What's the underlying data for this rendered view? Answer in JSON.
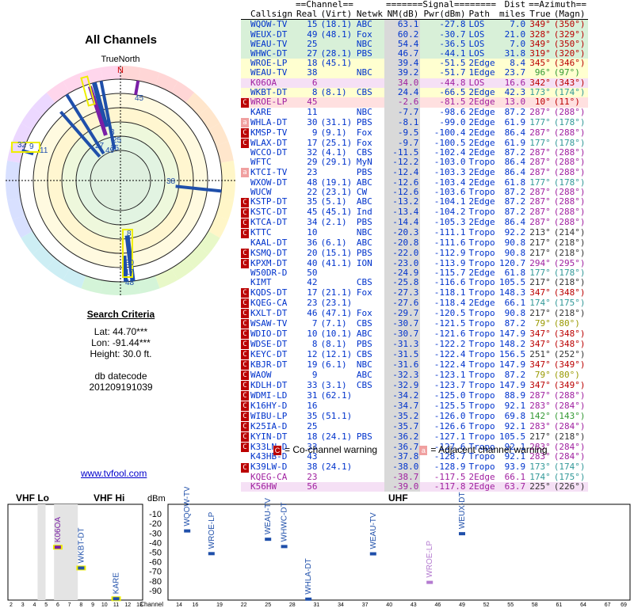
{
  "polar": {
    "title": "All Channels",
    "north_label": "TrueNorth",
    "n_label": "N",
    "ring_labels": [
      "45",
      "25",
      "15",
      "8",
      "5",
      "27",
      "49",
      "11",
      "32",
      "9",
      "38",
      "8",
      "30",
      "17",
      "48"
    ]
  },
  "criteria": {
    "header": "Search Criteria",
    "lat": "Lat: 44.70***",
    "lon": "Lon: -91.44***",
    "height": "Height: 30.0 ft.",
    "db_label": "db datecode",
    "db_value": "201209191039"
  },
  "table": {
    "group_headers": {
      "channel": "==Channel==",
      "signal": "=======Signal========",
      "dist": "Dist",
      "azimuth": "==Azimuth=="
    },
    "columns": [
      "Callsign",
      "Real",
      "(Virt)",
      "Netwk",
      "NM(dB)",
      "Pwr(dBm)",
      "Path",
      "miles",
      "True",
      "(Magn)"
    ],
    "rows": [
      {
        "flag": "",
        "call": "WQOW-TV",
        "real": "15",
        "virt": "(18.1)",
        "net": "ABC",
        "nm": "63.1",
        "pwr": "-27.8",
        "path": "LOS",
        "miles": "7.0",
        "tru": "349°",
        "mag": "(350°)",
        "bg": "#d8f0d8",
        "fg": "#0033cc",
        "az": "#b00"
      },
      {
        "flag": "",
        "call": "WEUX-DT",
        "real": "49",
        "virt": "(48.1)",
        "net": "Fox",
        "nm": "60.2",
        "pwr": "-30.7",
        "path": "LOS",
        "miles": "21.0",
        "tru": "328°",
        "mag": "(329°)",
        "bg": "#d8f0d8",
        "fg": "#0033cc",
        "az": "#b00"
      },
      {
        "flag": "",
        "call": "WEAU-TV",
        "real": "25",
        "virt": "",
        "net": "NBC",
        "nm": "54.4",
        "pwr": "-36.5",
        "path": "LOS",
        "miles": "7.0",
        "tru": "349°",
        "mag": "(350°)",
        "bg": "#d8f0d8",
        "fg": "#0033cc",
        "az": "#b00"
      },
      {
        "flag": "",
        "call": "WHWC-DT",
        "real": "27",
        "virt": "(28.1)",
        "net": "PBS",
        "nm": "46.7",
        "pwr": "-44.1",
        "path": "LOS",
        "miles": "31.8",
        "tru": "319°",
        "mag": "(320°)",
        "bg": "#d8f0d8",
        "fg": "#0033cc",
        "az": "#b00"
      },
      {
        "flag": "",
        "call": "WROE-LP",
        "real": "18",
        "virt": "(45.1)",
        "net": "",
        "nm": "39.4",
        "pwr": "-51.5",
        "path": "2Edge",
        "miles": "8.4",
        "tru": "345°",
        "mag": "(346°)",
        "bg": "#ffffd0",
        "fg": "#0033cc",
        "az": "#b00"
      },
      {
        "flag": "",
        "call": "WEAU-TV",
        "real": "38",
        "virt": "",
        "net": "NBC",
        "nm": "39.2",
        "pwr": "-51.7",
        "path": "1Edge",
        "miles": "23.7",
        "tru": "96°",
        "mag": "(97°)",
        "bg": "#ffffd0",
        "fg": "#0033cc",
        "az": "#393"
      },
      {
        "flag": "",
        "call": "K06OA",
        "real": "6",
        "virt": "",
        "net": "",
        "nm": "34.0",
        "pwr": "-44.8",
        "path": "LOS",
        "miles": "16.6",
        "tru": "342°",
        "mag": "(343°)",
        "bg": "#f5e0f5",
        "fg": "#a020a0",
        "az": "#b00"
      },
      {
        "flag": "",
        "call": "WKBT-DT",
        "real": "8",
        "virt": "(8.1)",
        "net": "CBS",
        "nm": "24.4",
        "pwr": "-66.5",
        "path": "2Edge",
        "miles": "42.3",
        "tru": "173°",
        "mag": "(174°)",
        "bg": "#ffffd0",
        "fg": "#0033cc",
        "az": "#399"
      },
      {
        "flag": "C",
        "call": "WROE-LP",
        "real": "45",
        "virt": "",
        "net": "",
        "nm": "-2.6",
        "pwr": "-81.5",
        "path": "2Edge",
        "miles": "13.0",
        "tru": "10°",
        "mag": "(11°)",
        "bg": "#ffe0e0",
        "fg": "#a020a0",
        "az": "#b00"
      },
      {
        "flag": "",
        "call": "KARE",
        "real": "11",
        "virt": "",
        "net": "NBC",
        "nm": "-7.7",
        "pwr": "-98.6",
        "path": "2Edge",
        "miles": "87.2",
        "tru": "287°",
        "mag": "(288°)",
        "bg": "#fff",
        "fg": "#0033cc",
        "az": "#a020a0"
      },
      {
        "flag": "a",
        "call": "WHLA-DT",
        "real": "30",
        "virt": "(31.1)",
        "net": "PBS",
        "nm": "-8.1",
        "pwr": "-99.0",
        "path": "2Edge",
        "miles": "61.9",
        "tru": "177°",
        "mag": "(178°)",
        "bg": "#fff",
        "fg": "#0033cc",
        "az": "#399"
      },
      {
        "flag": "C",
        "call": "KMSP-TV",
        "real": "9",
        "virt": "(9.1)",
        "net": "Fox",
        "nm": "-9.5",
        "pwr": "-100.4",
        "path": "2Edge",
        "miles": "86.4",
        "tru": "287°",
        "mag": "(288°)",
        "bg": "#fff",
        "fg": "#0033cc",
        "az": "#a020a0"
      },
      {
        "flag": "C",
        "call": "WLAX-DT",
        "real": "17",
        "virt": "(25.1)",
        "net": "Fox",
        "nm": "-9.7",
        "pwr": "-100.5",
        "path": "2Edge",
        "miles": "61.9",
        "tru": "177°",
        "mag": "(178°)",
        "bg": "#fff",
        "fg": "#0033cc",
        "az": "#399"
      },
      {
        "flag": "",
        "call": "WCCO-DT",
        "real": "32",
        "virt": "(4.1)",
        "net": "CBS",
        "nm": "-11.5",
        "pwr": "-102.4",
        "path": "2Edge",
        "miles": "87.2",
        "tru": "287°",
        "mag": "(288°)",
        "bg": "#fff",
        "fg": "#0033cc",
        "az": "#a020a0"
      },
      {
        "flag": "",
        "call": "WFTC",
        "real": "29",
        "virt": "(29.1)",
        "net": "MyN",
        "nm": "-12.2",
        "pwr": "-103.0",
        "path": "Tropo",
        "miles": "86.4",
        "tru": "287°",
        "mag": "(288°)",
        "bg": "#fff",
        "fg": "#0033cc",
        "az": "#a020a0"
      },
      {
        "flag": "a",
        "call": "KTCI-TV",
        "real": "23",
        "virt": "",
        "net": "PBS",
        "nm": "-12.4",
        "pwr": "-103.3",
        "path": "2Edge",
        "miles": "86.4",
        "tru": "287°",
        "mag": "(288°)",
        "bg": "#fff",
        "fg": "#0033cc",
        "az": "#a020a0"
      },
      {
        "flag": "",
        "call": "WXOW-DT",
        "real": "48",
        "virt": "(19.1)",
        "net": "ABC",
        "nm": "-12.6",
        "pwr": "-103.4",
        "path": "2Edge",
        "miles": "61.8",
        "tru": "177°",
        "mag": "(178°)",
        "bg": "#fff",
        "fg": "#0033cc",
        "az": "#399"
      },
      {
        "flag": "",
        "call": "WUCW",
        "real": "22",
        "virt": "(23.1)",
        "net": "CW",
        "nm": "-12.6",
        "pwr": "-103.6",
        "path": "Tropo",
        "miles": "87.2",
        "tru": "287°",
        "mag": "(288°)",
        "bg": "#fff",
        "fg": "#0033cc",
        "az": "#a020a0"
      },
      {
        "flag": "C",
        "call": "KSTP-DT",
        "real": "35",
        "virt": "(5.1)",
        "net": "ABC",
        "nm": "-13.2",
        "pwr": "-104.1",
        "path": "2Edge",
        "miles": "87.2",
        "tru": "287°",
        "mag": "(288°)",
        "bg": "#fff",
        "fg": "#0033cc",
        "az": "#a020a0"
      },
      {
        "flag": "C",
        "call": "KSTC-DT",
        "real": "45",
        "virt": "(45.1)",
        "net": "Ind",
        "nm": "-13.4",
        "pwr": "-104.2",
        "path": "Tropo",
        "miles": "87.2",
        "tru": "287°",
        "mag": "(288°)",
        "bg": "#fff",
        "fg": "#0033cc",
        "az": "#a020a0"
      },
      {
        "flag": "C",
        "call": "KTCA-DT",
        "real": "34",
        "virt": "(2.1)",
        "net": "PBS",
        "nm": "-14.4",
        "pwr": "-105.3",
        "path": "2Edge",
        "miles": "86.4",
        "tru": "287°",
        "mag": "(288°)",
        "bg": "#fff",
        "fg": "#0033cc",
        "az": "#a020a0"
      },
      {
        "flag": "C",
        "call": "KTTC",
        "real": "10",
        "virt": "",
        "net": "NBC",
        "nm": "-20.3",
        "pwr": "-111.1",
        "path": "Tropo",
        "miles": "92.2",
        "tru": "213°",
        "mag": "(214°)",
        "bg": "#fff",
        "fg": "#0033cc",
        "az": "#333"
      },
      {
        "flag": "",
        "call": "KAAL-DT",
        "real": "36",
        "virt": "(6.1)",
        "net": "ABC",
        "nm": "-20.8",
        "pwr": "-111.6",
        "path": "Tropo",
        "miles": "90.8",
        "tru": "217°",
        "mag": "(218°)",
        "bg": "#fff",
        "fg": "#0033cc",
        "az": "#333"
      },
      {
        "flag": "C",
        "call": "KSMQ-DT",
        "real": "20",
        "virt": "(15.1)",
        "net": "PBS",
        "nm": "-22.0",
        "pwr": "-112.9",
        "path": "Tropo",
        "miles": "90.8",
        "tru": "217°",
        "mag": "(218°)",
        "bg": "#fff",
        "fg": "#0033cc",
        "az": "#333"
      },
      {
        "flag": "C",
        "call": "KPXM-DT",
        "real": "40",
        "virt": "(41.1)",
        "net": "ION",
        "nm": "-23.0",
        "pwr": "-113.9",
        "path": "Tropo",
        "miles": "120.7",
        "tru": "294°",
        "mag": "(295°)",
        "bg": "#fff",
        "fg": "#0033cc",
        "az": "#a020a0"
      },
      {
        "flag": "",
        "call": "W50DR-D",
        "real": "50",
        "virt": "",
        "net": "",
        "nm": "-24.9",
        "pwr": "-115.7",
        "path": "2Edge",
        "miles": "61.8",
        "tru": "177°",
        "mag": "(178°)",
        "bg": "#fff",
        "fg": "#0033cc",
        "az": "#399"
      },
      {
        "flag": "",
        "call": "KIMT",
        "real": "42",
        "virt": "",
        "net": "CBS",
        "nm": "-25.8",
        "pwr": "-116.6",
        "path": "Tropo",
        "miles": "105.5",
        "tru": "217°",
        "mag": "(218°)",
        "bg": "#fff",
        "fg": "#0033cc",
        "az": "#333"
      },
      {
        "flag": "C",
        "call": "KQDS-DT",
        "real": "17",
        "virt": "(21.1)",
        "net": "Fox",
        "nm": "-27.3",
        "pwr": "-118.1",
        "path": "Tropo",
        "miles": "148.3",
        "tru": "347°",
        "mag": "(348°)",
        "bg": "#fff",
        "fg": "#0033cc",
        "az": "#b00"
      },
      {
        "flag": "C",
        "call": "KQEG-CA",
        "real": "23",
        "virt": "(23.1)",
        "net": "",
        "nm": "-27.6",
        "pwr": "-118.4",
        "path": "2Edge",
        "miles": "66.1",
        "tru": "174°",
        "mag": "(175°)",
        "bg": "#fff",
        "fg": "#0033cc",
        "az": "#399"
      },
      {
        "flag": "C",
        "call": "KXLT-DT",
        "real": "46",
        "virt": "(47.1)",
        "net": "Fox",
        "nm": "-29.7",
        "pwr": "-120.5",
        "path": "Tropo",
        "miles": "90.8",
        "tru": "217°",
        "mag": "(218°)",
        "bg": "#fff",
        "fg": "#0033cc",
        "az": "#333"
      },
      {
        "flag": "C",
        "call": "WSAW-TV",
        "real": "7",
        "virt": "(7.1)",
        "net": "CBS",
        "nm": "-30.7",
        "pwr": "-121.5",
        "path": "Tropo",
        "miles": "87.2",
        "tru": "79°",
        "mag": "(80°)",
        "bg": "#fff",
        "fg": "#0033cc",
        "az": "#990"
      },
      {
        "flag": "C",
        "call": "WDIO-DT",
        "real": "10",
        "virt": "(10.1)",
        "net": "ABC",
        "nm": "-30.7",
        "pwr": "-121.6",
        "path": "Tropo",
        "miles": "147.9",
        "tru": "347°",
        "mag": "(348°)",
        "bg": "#fff",
        "fg": "#0033cc",
        "az": "#b00"
      },
      {
        "flag": "C",
        "call": "WDSE-DT",
        "real": "8",
        "virt": "(8.1)",
        "net": "PBS",
        "nm": "-31.3",
        "pwr": "-122.2",
        "path": "Tropo",
        "miles": "148.2",
        "tru": "347°",
        "mag": "(348°)",
        "bg": "#fff",
        "fg": "#0033cc",
        "az": "#b00"
      },
      {
        "flag": "C",
        "call": "KEYC-DT",
        "real": "12",
        "virt": "(12.1)",
        "net": "CBS",
        "nm": "-31.5",
        "pwr": "-122.4",
        "path": "Tropo",
        "miles": "156.5",
        "tru": "251°",
        "mag": "(252°)",
        "bg": "#fff",
        "fg": "#0033cc",
        "az": "#333"
      },
      {
        "flag": "C",
        "call": "KBJR-DT",
        "real": "19",
        "virt": "(6.1)",
        "net": "NBC",
        "nm": "-31.6",
        "pwr": "-122.4",
        "path": "Tropo",
        "miles": "147.9",
        "tru": "347°",
        "mag": "(349°)",
        "bg": "#fff",
        "fg": "#0033cc",
        "az": "#b00"
      },
      {
        "flag": "C",
        "call": "WAOW",
        "real": "9",
        "virt": "",
        "net": "ABC",
        "nm": "-32.3",
        "pwr": "-123.1",
        "path": "Tropo",
        "miles": "87.2",
        "tru": "79°",
        "mag": "(80°)",
        "bg": "#fff",
        "fg": "#0033cc",
        "az": "#990"
      },
      {
        "flag": "C",
        "call": "KDLH-DT",
        "real": "33",
        "virt": "(3.1)",
        "net": "CBS",
        "nm": "-32.9",
        "pwr": "-123.7",
        "path": "Tropo",
        "miles": "147.9",
        "tru": "347°",
        "mag": "(349°)",
        "bg": "#fff",
        "fg": "#0033cc",
        "az": "#b00"
      },
      {
        "flag": "C",
        "call": "WDMI-LD",
        "real": "31",
        "virt": "(62.1)",
        "net": "",
        "nm": "-34.2",
        "pwr": "-125.0",
        "path": "Tropo",
        "miles": "88.9",
        "tru": "287°",
        "mag": "(288°)",
        "bg": "#fff",
        "fg": "#0033cc",
        "az": "#a020a0"
      },
      {
        "flag": "C",
        "call": "K16HY-D",
        "real": "16",
        "virt": "",
        "net": "",
        "nm": "-34.7",
        "pwr": "-125.5",
        "path": "Tropo",
        "miles": "92.1",
        "tru": "283°",
        "mag": "(284°)",
        "bg": "#fff",
        "fg": "#0033cc",
        "az": "#a020a0"
      },
      {
        "flag": "C",
        "call": "WIBU-LP",
        "real": "35",
        "virt": "(51.1)",
        "net": "",
        "nm": "-35.2",
        "pwr": "-126.0",
        "path": "Tropo",
        "miles": "69.8",
        "tru": "142°",
        "mag": "(143°)",
        "bg": "#fff",
        "fg": "#0033cc",
        "az": "#393"
      },
      {
        "flag": "C",
        "call": "K25IA-D",
        "real": "25",
        "virt": "",
        "net": "",
        "nm": "-35.7",
        "pwr": "-126.6",
        "path": "Tropo",
        "miles": "92.1",
        "tru": "283°",
        "mag": "(284°)",
        "bg": "#fff",
        "fg": "#0033cc",
        "az": "#a020a0"
      },
      {
        "flag": "C",
        "call": "KYIN-DT",
        "real": "18",
        "virt": "(24.1)",
        "net": "PBS",
        "nm": "-36.2",
        "pwr": "-127.1",
        "path": "Tropo",
        "miles": "105.5",
        "tru": "217°",
        "mag": "(218°)",
        "bg": "#fff",
        "fg": "#0033cc",
        "az": "#333"
      },
      {
        "flag": "C",
        "call": "K33LN-D",
        "real": "33",
        "virt": "",
        "net": "",
        "nm": "-36.7",
        "pwr": "-127.6",
        "path": "Tropo",
        "miles": "92.1",
        "tru": "283°",
        "mag": "(284°)",
        "bg": "#fff",
        "fg": "#0033cc",
        "az": "#a020a0"
      },
      {
        "flag": "",
        "call": "K43HB-D",
        "real": "43",
        "virt": "",
        "net": "",
        "nm": "-37.8",
        "pwr": "-128.7",
        "path": "Tropo",
        "miles": "92.1",
        "tru": "283°",
        "mag": "(284°)",
        "bg": "#fff",
        "fg": "#0033cc",
        "az": "#a020a0"
      },
      {
        "flag": "C",
        "call": "K39LW-D",
        "real": "38",
        "virt": "(24.1)",
        "net": "",
        "nm": "-38.0",
        "pwr": "-128.9",
        "path": "Tropo",
        "miles": "93.9",
        "tru": "173°",
        "mag": "(174°)",
        "bg": "#fff",
        "fg": "#0033cc",
        "az": "#399"
      },
      {
        "flag": "",
        "call": "KQEG-CA",
        "real": "23",
        "virt": "",
        "net": "",
        "nm": "-38.7",
        "pwr": "-117.5",
        "path": "2Edge",
        "miles": "66.1",
        "tru": "174°",
        "mag": "(175°)",
        "bg": "#fff",
        "fg": "#a020a0",
        "az": "#399"
      },
      {
        "flag": "",
        "call": "K56HW",
        "real": "56",
        "virt": "",
        "net": "",
        "nm": "-39.0",
        "pwr": "-117.8",
        "path": "2Edge",
        "miles": "63.7",
        "tru": "225°",
        "mag": "(226°)",
        "bg": "#f5e0f5",
        "fg": "#a020a0",
        "az": "#333"
      }
    ]
  },
  "legend": {
    "co_flag": "C",
    "co_text": "= Co-channel warning",
    "adj_flag": "a",
    "adj_text": "= Adjacent channel warning"
  },
  "link_text": "www.tvfool.com",
  "spectrum": {
    "vhf_lo": "VHF Lo",
    "vhf_hi": "VHF Hi",
    "uhf": "UHF",
    "dbm_label": "dBm",
    "channel_label": "Channel",
    "db_ticks": [
      "-10",
      "-20",
      "-30",
      "-40",
      "-50",
      "-60",
      "-70",
      "-80",
      "-90"
    ],
    "channel_ticks": [
      "2",
      "3",
      "4",
      "5",
      "6",
      "7",
      "8",
      "9",
      "10",
      "11",
      "12",
      "13",
      "14",
      "16",
      "19",
      "22",
      "25",
      "28",
      "31",
      "34",
      "37",
      "40",
      "43",
      "46",
      "49",
      "52",
      "55",
      "58",
      "61",
      "64",
      "67",
      "69"
    ],
    "stations": [
      {
        "label": "K06OA",
        "ch": 6,
        "dbm": -44.8
      },
      {
        "label": "WKBT-DT",
        "ch": 8,
        "dbm": -66.5
      },
      {
        "label": "KARE",
        "ch": 11,
        "dbm": -98.6
      },
      {
        "label": "WQOW-TV",
        "ch": 15,
        "dbm": -27.8
      },
      {
        "label": "WROE-LP",
        "ch": 18,
        "dbm": -51.5
      },
      {
        "label": "WEAU-TV",
        "ch": 25,
        "dbm": -36.5
      },
      {
        "label": "WHWC-DT",
        "ch": 27,
        "dbm": -44.1
      },
      {
        "label": "WHLA-DT",
        "ch": 30,
        "dbm": -99.0
      },
      {
        "label": "WEAU-TV",
        "ch": 38,
        "dbm": -51.7
      },
      {
        "label": "WROE-LP",
        "ch": 45,
        "dbm": -81.5
      },
      {
        "label": "WEUX-DT",
        "ch": 49,
        "dbm": -30.7
      }
    ]
  }
}
